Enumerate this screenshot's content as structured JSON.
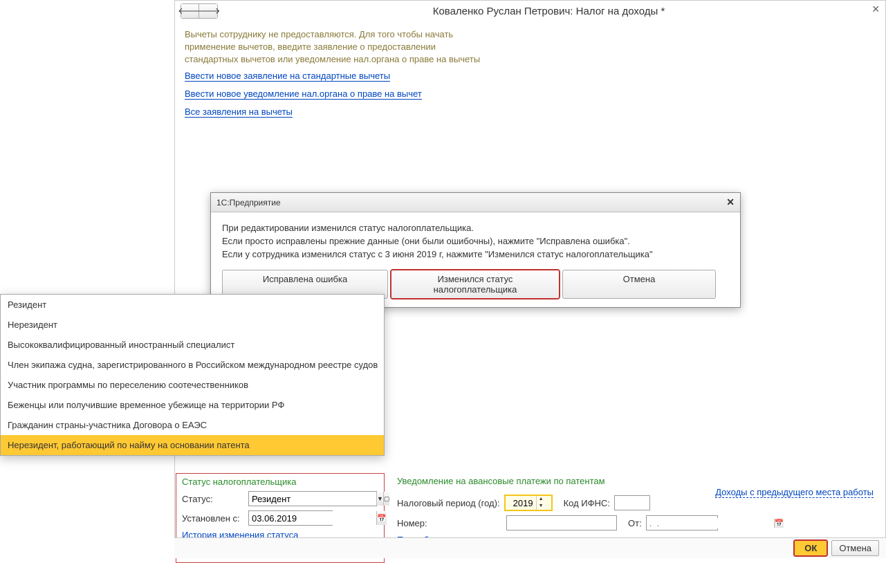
{
  "window": {
    "title": "Коваленко Руслан Петрович: Налог на доходы *",
    "info_text": "Вычеты сотруднику не предоставляются. Для того чтобы начать применение вычетов, введите заявление о предоставлении стандартных вычетов или уведомление нал.органа о праве на вычеты",
    "link1": "Ввести новое заявление на стандартные вычеты",
    "link2": "Ввести новое уведомление нал.органа о праве на вычет",
    "link3": "Все заявления на вычеты"
  },
  "dialog": {
    "title": "1С:Предприятие",
    "line1": "При редактировании изменился статус налогоплательщика.",
    "line2": "Если просто исправлены прежние данные (они были ошибочны), нажмите \"Исправлена ошибка\".",
    "line3": "Если у сотрудника изменился статус с 3 июня 2019 г, нажмите \"Изменился статус налогоплательщика\"",
    "btn1": "Исправлена ошибка",
    "btn2": "Изменился статус налогоплательщика",
    "btn3": "Отмена"
  },
  "dropdown": {
    "items": [
      "Резидент",
      "Нерезидент",
      "Высококвалифицированный иностранный специалист",
      "Член экипажа судна, зарегистрированного в Российском международном реестре судов",
      "Участник программы по переселению соотечественников",
      "Беженцы или получившие временное убежище на территории РФ",
      "Гражданин страны-участника Договора о ЕАЭС",
      "Нерезидент, работающий по найму на основании патента"
    ]
  },
  "status_group": {
    "title": "Статус налогоплательщика",
    "status_label": "Статус:",
    "status_value": "Резидент",
    "date_label": "Установлен с:",
    "date_value": "03.06.2019",
    "history_link": "История изменения статуса налогоплательщика"
  },
  "notice_group": {
    "title": "Уведомление на авансовые платежи по патентам",
    "period_label": "Налоговый период (год):",
    "period_value": "2019",
    "ifns_label": "Код ИФНС:",
    "number_label": "Номер:",
    "from_label": "От:",
    "from_placeholder": ".  .",
    "more_link": "Подробнее"
  },
  "right_link": "Доходы с предыдущего места работы",
  "footer": {
    "ok": "ОК",
    "cancel": "Отмена"
  }
}
